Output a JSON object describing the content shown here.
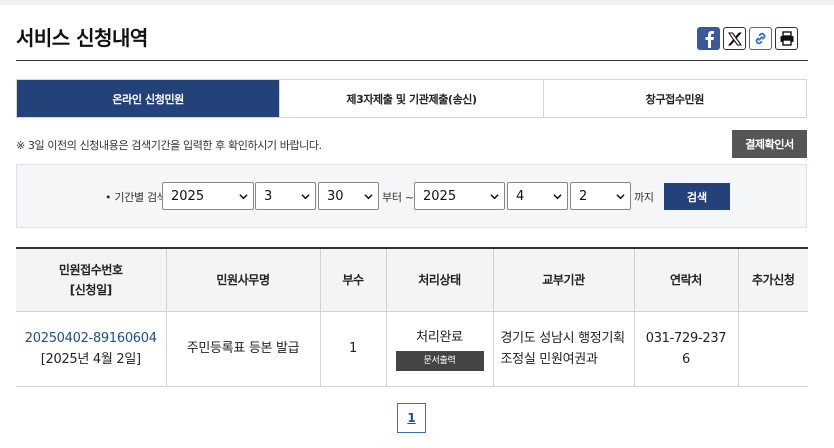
{
  "header": {
    "title": "서비스 신청내역"
  },
  "share": {
    "facebook_icon": "facebook-icon",
    "x_icon": "x-twitter-icon",
    "link_icon": "link-copy-icon",
    "print_icon": "printer-icon"
  },
  "tabs": [
    {
      "label": "온라인 신청민원",
      "active": true
    },
    {
      "label": "제3자제출 및 기관제출(송신)",
      "active": false
    },
    {
      "label": "창구접수민원",
      "active": false
    }
  ],
  "notice": "※ 3일 이전의 신청내용은 검색기간을 입력한 후 확인하시기 바랍니다.",
  "confirm_button": "결제확인서",
  "search": {
    "label": "• 기간별 검색",
    "from_year": "2025",
    "from_month": "3",
    "from_day": "30",
    "from_suffix": "부터 ~",
    "to_year": "2025",
    "to_month": "4",
    "to_day": "2",
    "to_suffix": "까지",
    "button": "검색"
  },
  "table": {
    "headers": {
      "receipt_line1": "민원접수번호",
      "receipt_line2": "[신청일]",
      "service_name": "민원사무명",
      "copies": "부수",
      "status": "처리상태",
      "agency": "교부기관",
      "contact": "연락처",
      "extra": "추가신청"
    },
    "rows": [
      {
        "receipt_no": "20250402-89160604",
        "apply_date": "[2025년 4월 2일]",
        "service_name": "주민등록표 등본 발급",
        "copies": "1",
        "status": "처리완료",
        "print_button": "문서출력",
        "agency_line1": "경기도 성남시 행정기획",
        "agency_line2": "조정실 민원여권과",
        "contact_line1": "031-729-237",
        "contact_line2": "6",
        "extra": ""
      }
    ]
  },
  "pagination": {
    "current": "1"
  }
}
